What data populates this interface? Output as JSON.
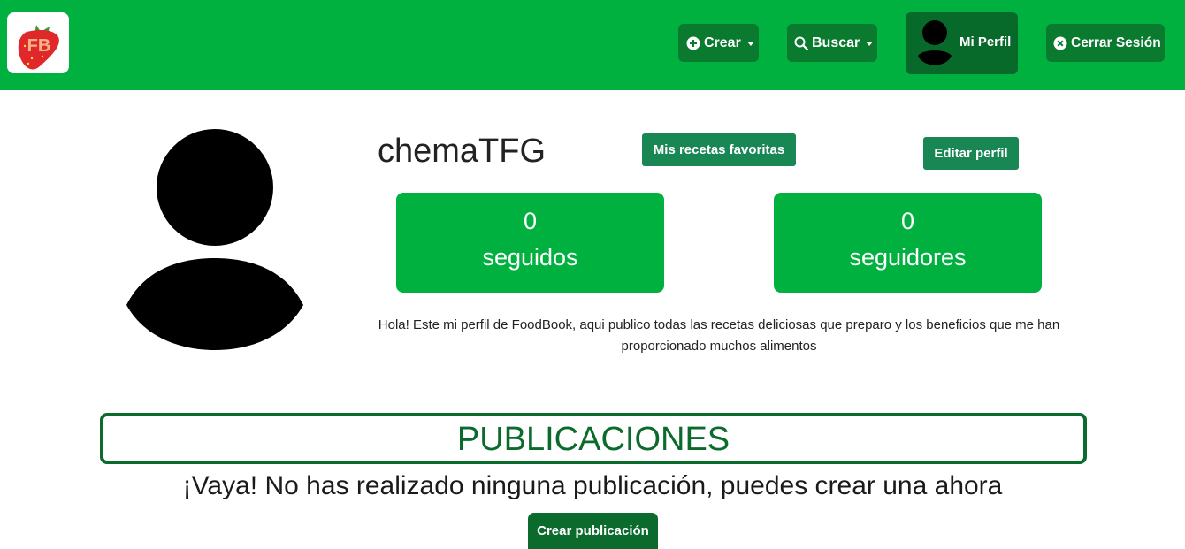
{
  "brand": {
    "logo_text": "FB",
    "logo_icon": "strawberry-logo"
  },
  "nav": {
    "crear_label": "Crear",
    "buscar_label": "Buscar",
    "perfil_label": "Mi Perfil",
    "cerrar_label": "Cerrar Sesión",
    "icons": {
      "crear": "plus-circle-icon",
      "buscar": "search-icon",
      "perfil": "user-avatar-icon",
      "cerrar": "x-circle-icon"
    }
  },
  "profile": {
    "username": "chemaTFG",
    "favorites_button": "Mis recetas favoritas",
    "edit_button": "Editar perfil",
    "following_count": "0",
    "following_label": "seguidos",
    "followers_count": "0",
    "followers_label": "seguidores",
    "bio": "Hola! Este mi perfil de FoodBook, aqui publico todas las recetas deliciosas que preparo y los beneficios que me han proporcionado muchos alimentos"
  },
  "publications": {
    "title": "PUBLICACIONES",
    "empty_message": "¡Vaya! No has realizado ninguna publicación, puedes crear una ahora",
    "create_button": "Crear publicación"
  },
  "colors": {
    "nav_green": "#00b140",
    "dark_green": "#0a6b2c",
    "button_green": "#198754"
  }
}
